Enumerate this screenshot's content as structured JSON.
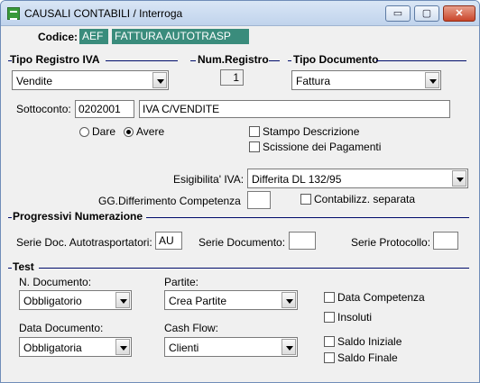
{
  "window": {
    "title": "CAUSALI CONTABILI / Interroga",
    "minimize": "▭",
    "maximize": "▢",
    "close": "✕"
  },
  "codice": {
    "label": "Codice:",
    "code": "AEF",
    "description": "FATTURA AUTOTRASP"
  },
  "tipo_registro": {
    "label": "Tipo Registro IVA",
    "value": "Vendite"
  },
  "num_registro": {
    "label": "Num.Registro",
    "value": "1"
  },
  "tipo_documento": {
    "label": "Tipo Documento",
    "value": "Fattura"
  },
  "sottoconto": {
    "label": "Sottoconto:",
    "code": "0202001",
    "description": "IVA C/VENDITE"
  },
  "segno": {
    "dare": "Dare",
    "avere": "Avere",
    "selected": "avere"
  },
  "options": {
    "stampo_descrizione": "Stampo Descrizione",
    "scissione_pagamenti": "Scissione dei Pagamenti"
  },
  "esigibilita": {
    "label": "Esigibilita' IVA:",
    "value": "Differita DL 132/95"
  },
  "gg_differimento": {
    "label": "GG.Differimento Competenza",
    "value": ""
  },
  "contabilizz": {
    "label": "Contabilizz. separata"
  },
  "progressivi": {
    "label": "Progressivi Numerazione",
    "serie_autotrasp_label": "Serie Doc. Autotrasportatori:",
    "serie_autotrasp_value": "AU",
    "serie_documento_label": "Serie Documento:",
    "serie_documento_value": "",
    "serie_protocollo_label": "Serie Protocollo:",
    "serie_protocollo_value": ""
  },
  "test": {
    "label": "Test",
    "n_documento_label": "N. Documento:",
    "n_documento_value": "Obbligatorio",
    "partite_label": "Partite:",
    "partite_value": "Crea Partite",
    "data_documento_label": "Data Documento:",
    "data_documento_value": "Obbligatoria",
    "cash_flow_label": "Cash Flow:",
    "cash_flow_value": "Clienti",
    "data_competenza": "Data Competenza",
    "insoluti": "Insoluti",
    "saldo_iniziale": "Saldo Iniziale",
    "saldo_finale": "Saldo Finale"
  }
}
